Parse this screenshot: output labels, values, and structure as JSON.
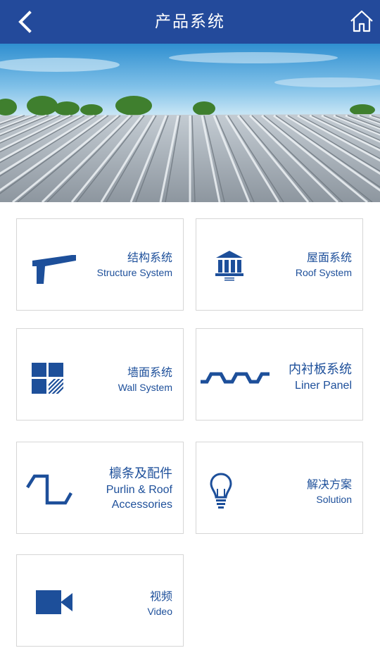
{
  "header": {
    "title": "产品系统",
    "back_icon": "chevron-left-icon",
    "home_icon": "home-icon",
    "background": "#234a9b"
  },
  "accent_color": "#1d4f9a",
  "cards": [
    {
      "zh": "结构系统",
      "en": "Structure System",
      "icon": "structure-beam-icon"
    },
    {
      "zh": "屋面系统",
      "en": "Roof System",
      "icon": "building-columns-icon"
    },
    {
      "zh": "墙面系统",
      "en": "Wall System",
      "icon": "wall-tiles-icon"
    },
    {
      "zh": "内衬板系统",
      "en": "Liner Panel",
      "icon": "corrugated-panel-icon"
    },
    {
      "zh": "檩条及配件",
      "en1": "Purlin & Roof",
      "en2": "Accessories",
      "icon": "purlin-profile-icon"
    },
    {
      "zh": "解决方案",
      "en": "Solution",
      "icon": "lightbulb-icon"
    },
    {
      "zh": "视频",
      "en": "Video",
      "icon": "video-camera-icon"
    }
  ]
}
